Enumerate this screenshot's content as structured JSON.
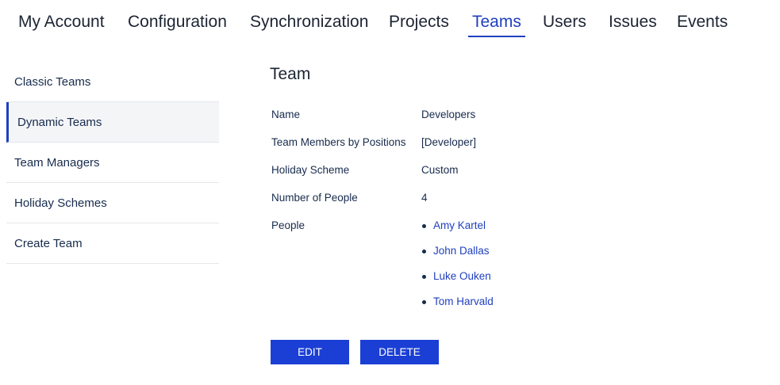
{
  "nav": {
    "tabs": [
      {
        "label": "My Account",
        "active": false
      },
      {
        "label": "Configuration",
        "active": false
      },
      {
        "label": "Synchronization",
        "active": false
      },
      {
        "label": "Projects",
        "active": false
      },
      {
        "label": "Teams",
        "active": true
      },
      {
        "label": "Users",
        "active": false
      },
      {
        "label": "Issues",
        "active": false
      },
      {
        "label": "Events",
        "active": false
      }
    ]
  },
  "sidebar": {
    "items": [
      {
        "label": "Classic Teams",
        "active": false
      },
      {
        "label": "Dynamic Teams",
        "active": true
      },
      {
        "label": "Team Managers",
        "active": false
      },
      {
        "label": "Holiday Schemes",
        "active": false
      },
      {
        "label": "Create Team",
        "active": false
      }
    ]
  },
  "main": {
    "title": "Team",
    "fields": {
      "name_label": "Name",
      "name_value": "Developers",
      "positions_label": "Team Members by Positions",
      "positions_value": "[Developer]",
      "holiday_label": "Holiday Scheme",
      "holiday_value": "Custom",
      "count_label": "Number of People",
      "count_value": "4",
      "people_label": "People"
    },
    "people": [
      "Amy Kartel",
      "John Dallas",
      "Luke Ouken",
      "Tom Harvald"
    ],
    "buttons": {
      "edit": "EDIT",
      "delete": "DELETE"
    }
  },
  "colors": {
    "accent": "#1f3fbf",
    "button": "#1b3fd4",
    "text": "#172b4d",
    "active_bg": "#f4f5f7"
  }
}
